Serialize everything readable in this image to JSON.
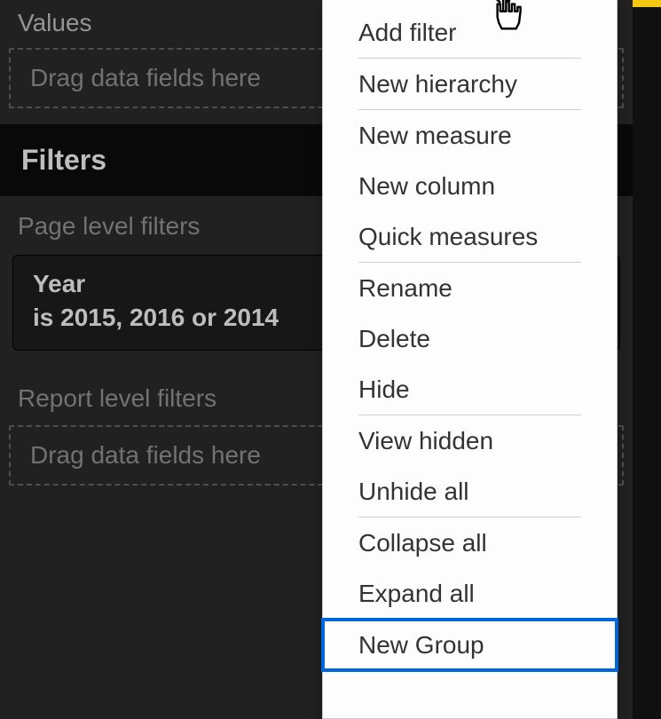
{
  "panel": {
    "values_label": "Values",
    "values_placeholder": "Drag data fields here",
    "filters_heading": "Filters",
    "page_filters_label": "Page level filters",
    "filter_card": {
      "field": "Year",
      "description": "is 2015, 2016 or 2014"
    },
    "report_filters_label": "Report level filters",
    "report_placeholder": "Drag data fields here"
  },
  "context_menu": {
    "items": [
      {
        "label": "Add filter"
      },
      {
        "label": "New hierarchy"
      },
      {
        "label": "New measure"
      },
      {
        "label": "New column"
      },
      {
        "label": "Quick measures"
      },
      {
        "label": "Rename"
      },
      {
        "label": "Delete"
      },
      {
        "label": "Hide"
      },
      {
        "label": "View hidden"
      },
      {
        "label": "Unhide all"
      },
      {
        "label": "Collapse all"
      },
      {
        "label": "Expand all"
      },
      {
        "label": "New Group",
        "highlight": true
      }
    ]
  }
}
